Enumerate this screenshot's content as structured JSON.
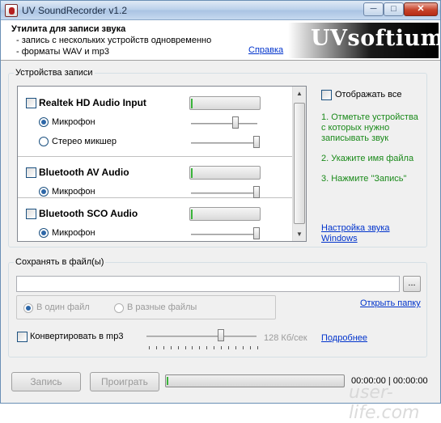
{
  "window": {
    "title": "UV SoundRecorder v1.2",
    "min_symbol": "─",
    "max_symbol": "□",
    "close_symbol": "✕"
  },
  "header": {
    "title": "Утилита для записи звука",
    "line1": "- запись с нескольких устройств одновременно",
    "line2": "- форматы WAV и mp3",
    "help_link": "Справка",
    "logo_text": "UVsoftium"
  },
  "recording": {
    "group_title": "Устройства записи",
    "devices": [
      {
        "name": "Realtek HD Audio Input",
        "checked": false,
        "inputs": [
          {
            "label": "Микрофон",
            "selected": true,
            "level": 0.6
          },
          {
            "label": "Стерео микшер",
            "selected": false,
            "level": 1.0
          }
        ]
      },
      {
        "name": "Bluetooth AV Audio",
        "checked": false,
        "inputs": [
          {
            "label": "Микрофон",
            "selected": true,
            "level": 1.0
          }
        ]
      },
      {
        "name": "Bluetooth SCO Audio",
        "checked": false,
        "inputs": [
          {
            "label": "Микрофон",
            "selected": true,
            "level": 1.0
          }
        ]
      }
    ],
    "show_all_label": "Отображать все",
    "instructions": [
      "1. Отметьте устройства с которых нужно записывать звук",
      "2. Укажите имя файла",
      "3. Нажмите \"Запись\""
    ],
    "sound_settings_link": "Настройка звука Windows"
  },
  "save": {
    "group_title": "Сохранять в файл(ы)",
    "path_value": "",
    "browse_label": "...",
    "one_file_label": "В один файл",
    "separate_files_label": "В разные файлы",
    "open_folder_link": "Открыть папку",
    "convert_label": "Конвертировать в mp3",
    "bitrate_label": "128 Кб/сек",
    "bitrate_level": 0.62,
    "more_link": "Подробнее"
  },
  "controls": {
    "record_label": "Запись",
    "play_label": "Проиграть",
    "time_label": "00:00:00 | 00:00:00",
    "progress": 0.0
  },
  "watermark": "user-life.com"
}
